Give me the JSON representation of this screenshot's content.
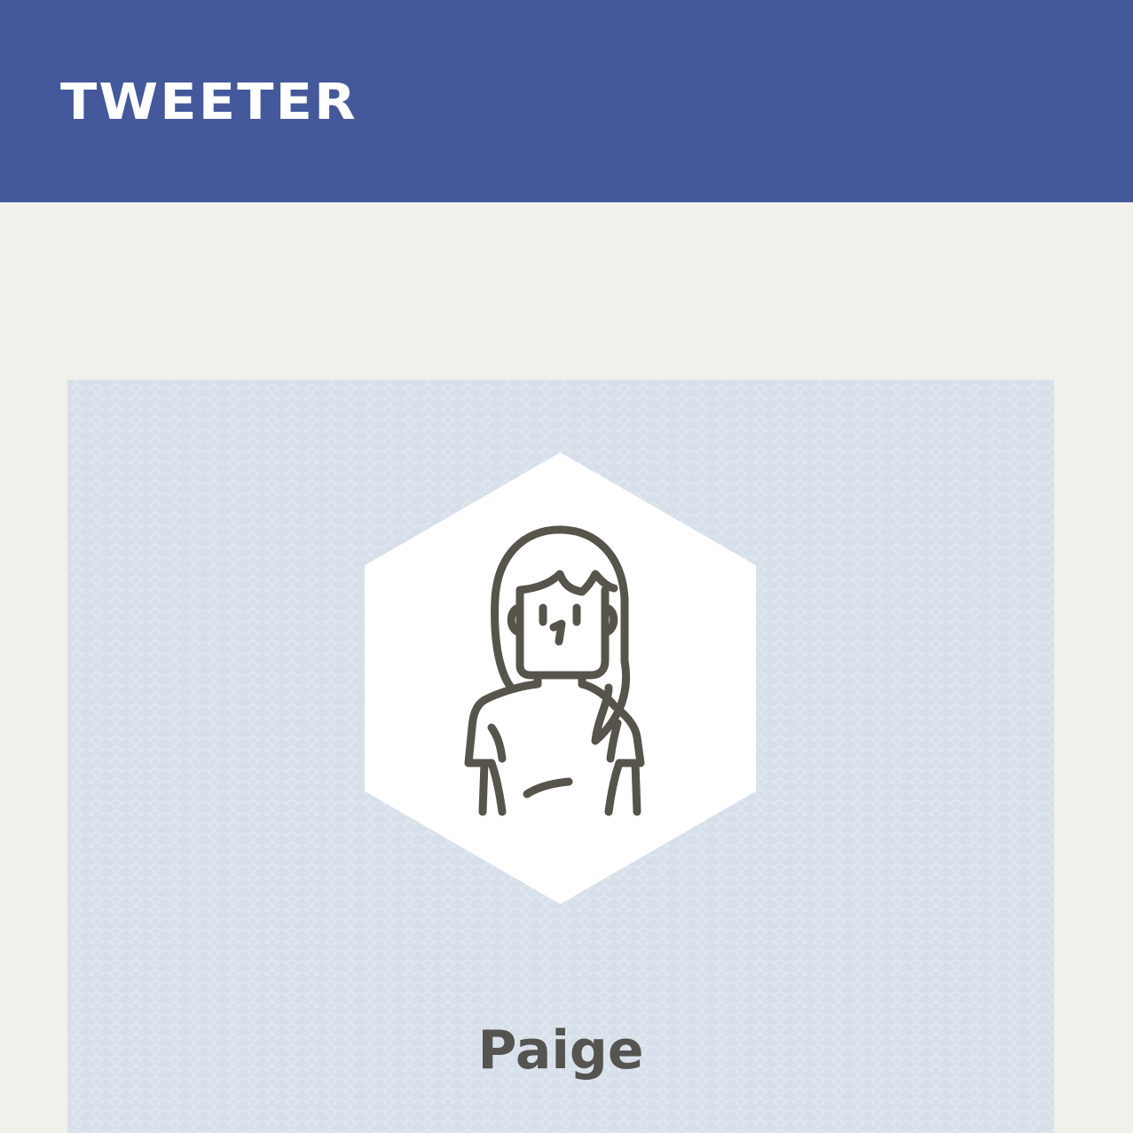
{
  "header": {
    "brand": "TWEETER"
  },
  "profile": {
    "name": "Paige",
    "avatar_icon": "woman-avatar-icon"
  },
  "colors": {
    "header_bg": "#44589c",
    "page_bg": "#f2f0eb",
    "card_bg": "#d7e0ea",
    "icon_stroke": "#57544c"
  }
}
